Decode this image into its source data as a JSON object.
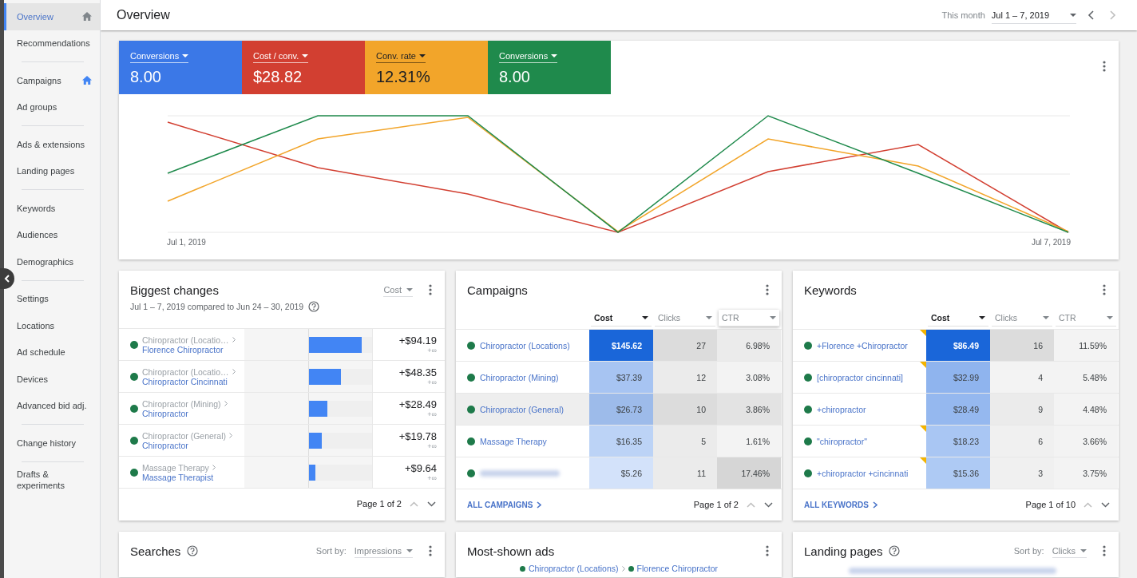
{
  "sidebar": {
    "groups": [
      [
        {
          "label": "Overview",
          "selected": true,
          "home": true,
          "home_active": false
        },
        {
          "label": "Recommendations",
          "selected": false,
          "home": false
        }
      ],
      [
        {
          "label": "Campaigns",
          "selected": false,
          "home": true,
          "home_active": true
        },
        {
          "label": "Ad groups",
          "selected": false,
          "home": false
        }
      ],
      [
        {
          "label": "Ads & extensions",
          "selected": false,
          "home": false
        },
        {
          "label": "Landing pages",
          "selected": false,
          "home": false
        }
      ],
      [
        {
          "label": "Keywords",
          "selected": false,
          "home": false
        },
        {
          "label": "Audiences",
          "selected": false,
          "home": false
        },
        {
          "label": "Demographics",
          "selected": false,
          "home": false
        }
      ],
      [
        {
          "label": "Settings",
          "selected": false,
          "home": false
        },
        {
          "label": "Locations",
          "selected": false,
          "home": false
        },
        {
          "label": "Ad schedule",
          "selected": false,
          "home": false
        },
        {
          "label": "Devices",
          "selected": false,
          "home": false
        },
        {
          "label": "Advanced bid adj.",
          "selected": false,
          "home": false
        }
      ],
      [
        {
          "label": "Change history",
          "selected": false,
          "home": false
        }
      ],
      [
        {
          "label": "Drafts & experiments",
          "selected": false,
          "home": false
        }
      ]
    ]
  },
  "header": {
    "title": "Overview",
    "range_label": "This month",
    "range": "Jul 1 – 7, 2019"
  },
  "overview": {
    "metrics": [
      {
        "label": "Conversions",
        "value": "8.00",
        "color": "#3b78e7",
        "dark_text": false
      },
      {
        "label": "Cost / conv.",
        "value": "$28.82",
        "color": "#d23f31",
        "dark_text": false
      },
      {
        "label": "Conv. rate",
        "value": "12.31%",
        "color": "#f2a52a",
        "dark_text": true
      },
      {
        "label": "Conversions",
        "value": "8.00",
        "color": "#1f8a4c",
        "dark_text": false
      }
    ],
    "x_start": "Jul 1, 2019",
    "x_end": "Jul 7, 2019"
  },
  "biggest_changes": {
    "title": "Biggest changes",
    "subtitle": "Jul 1 – 7, 2019 compared to Jun 24 – 30, 2019",
    "metric": "Cost",
    "rows": [
      {
        "parent": "Chiropractor (Locatio…",
        "child": "Florence Chiropractor",
        "level": 0.84,
        "value": "+$94.19",
        "change": "+∞"
      },
      {
        "parent": "Chiropractor (Locatio…",
        "child": "Chiropractor Cincinnati",
        "level": 0.51,
        "value": "+$48.35",
        "change": "+∞"
      },
      {
        "parent": "Chiropractor (Mining)",
        "child": "Chiropractor",
        "level": 0.29,
        "value": "+$28.49",
        "change": "+∞"
      },
      {
        "parent": "Chiropractor (General)",
        "child": "Chiropractor",
        "level": 0.2,
        "value": "+$19.78",
        "change": "+∞"
      },
      {
        "parent": "Massage Therapy",
        "child": "Massage Therapist",
        "level": 0.1,
        "value": "+$9.64",
        "change": "+∞"
      }
    ],
    "pager": "Page 1 of 2"
  },
  "campaigns": {
    "title": "Campaigns",
    "columns": [
      {
        "label": "Cost",
        "sorted": true,
        "raised": false
      },
      {
        "label": "Clicks",
        "sorted": false,
        "raised": false
      },
      {
        "label": "CTR",
        "sorted": false,
        "raised": true
      }
    ],
    "rows": [
      {
        "name": "Chiropractor (Locations)",
        "blurred": false,
        "highlighted": false,
        "flagged": false,
        "cells": [
          {
            "text": "$145.62",
            "color": "#1a66d9"
          },
          {
            "text": "27",
            "color": "#dcdcdc"
          },
          {
            "text": "6.98%",
            "color": "#ebebeb"
          }
        ]
      },
      {
        "name": "Chiropractor (Mining)",
        "blurred": false,
        "highlighted": false,
        "flagged": false,
        "cells": [
          {
            "text": "$37.39",
            "color": "#a7c4f2"
          },
          {
            "text": "12",
            "color": "#ebebeb"
          },
          {
            "text": "3.08%",
            "color": "#f3f3f3"
          }
        ]
      },
      {
        "name": "Chiropractor (General)",
        "blurred": false,
        "highlighted": true,
        "flagged": false,
        "cells": [
          {
            "text": "$26.73",
            "color": "#9dbbea"
          },
          {
            "text": "10",
            "color": "#dcdcdc"
          },
          {
            "text": "3.86%",
            "color": "#e3e3e3"
          }
        ]
      },
      {
        "name": "Massage Therapy",
        "blurred": false,
        "highlighted": false,
        "flagged": false,
        "cells": [
          {
            "text": "$16.35",
            "color": "#bcd3f6"
          },
          {
            "text": "5",
            "color": "#ebebeb"
          },
          {
            "text": "1.61%",
            "color": "#f3f3f3"
          }
        ]
      },
      {
        "name": "",
        "blurred": true,
        "highlighted": false,
        "flagged": false,
        "cells": [
          {
            "text": "$5.26",
            "color": "#d3e2fa"
          },
          {
            "text": "11",
            "color": "#ebebeb"
          },
          {
            "text": "17.46%",
            "color": "#d6d6d6"
          }
        ]
      }
    ],
    "link": "ALL CAMPAIGNS",
    "pager": "Page 1 of 2"
  },
  "keywords": {
    "title": "Keywords",
    "columns": [
      {
        "label": "Cost",
        "sorted": true,
        "raised": false
      },
      {
        "label": "Clicks",
        "sorted": false,
        "raised": false
      },
      {
        "label": "CTR",
        "sorted": false,
        "raised": false
      }
    ],
    "rows": [
      {
        "name": "+Florence +Chiropractor",
        "blurred": false,
        "highlighted": false,
        "flagged": true,
        "cells": [
          {
            "text": "$86.49",
            "color": "#1a66d9"
          },
          {
            "text": "16",
            "color": "#dcdcdc"
          },
          {
            "text": "11.59%",
            "color": "#f3f3f3"
          }
        ]
      },
      {
        "name": "[chiropractor cincinnati]",
        "blurred": false,
        "highlighted": false,
        "flagged": true,
        "cells": [
          {
            "text": "$32.99",
            "color": "#8fb4ee"
          },
          {
            "text": "4",
            "color": "#f3f3f3"
          },
          {
            "text": "5.48%",
            "color": "#f3f3f3"
          }
        ]
      },
      {
        "name": "+chiropractor",
        "blurred": false,
        "highlighted": false,
        "flagged": false,
        "cells": [
          {
            "text": "$28.49",
            "color": "#95b8ef"
          },
          {
            "text": "9",
            "color": "#ebebeb"
          },
          {
            "text": "4.48%",
            "color": "#f3f3f3"
          }
        ]
      },
      {
        "name": "\"chiropractor\"",
        "blurred": false,
        "highlighted": false,
        "flagged": true,
        "cells": [
          {
            "text": "$18.23",
            "color": "#a9c6f3"
          },
          {
            "text": "6",
            "color": "#f0f0f0"
          },
          {
            "text": "3.66%",
            "color": "#f3f3f3"
          }
        ]
      },
      {
        "name": "+chiropractor +cincinnati",
        "blurred": false,
        "highlighted": false,
        "flagged": true,
        "cells": [
          {
            "text": "$15.36",
            "color": "#aecaf4"
          },
          {
            "text": "3",
            "color": "#f0f0f0"
          },
          {
            "text": "3.75%",
            "color": "#f3f3f3"
          }
        ]
      }
    ],
    "link": "ALL KEYWORDS",
    "pager": "Page 1 of 10"
  },
  "bottom_cards": [
    {
      "kind": "sort",
      "title": "Searches",
      "help": true,
      "sort_label": "Sort by:",
      "sort_value": "Impressions"
    },
    {
      "kind": "ad",
      "title": "Most-shown ads",
      "help": false,
      "ad_campaign": "Chiropractor (Locations)",
      "ad_group": "Florence Chiropractor"
    },
    {
      "kind": "sort",
      "title": "Landing pages",
      "help": true,
      "sort_label": "Sort by:",
      "sort_value": "Clicks",
      "blurred_url": true
    }
  ]
}
